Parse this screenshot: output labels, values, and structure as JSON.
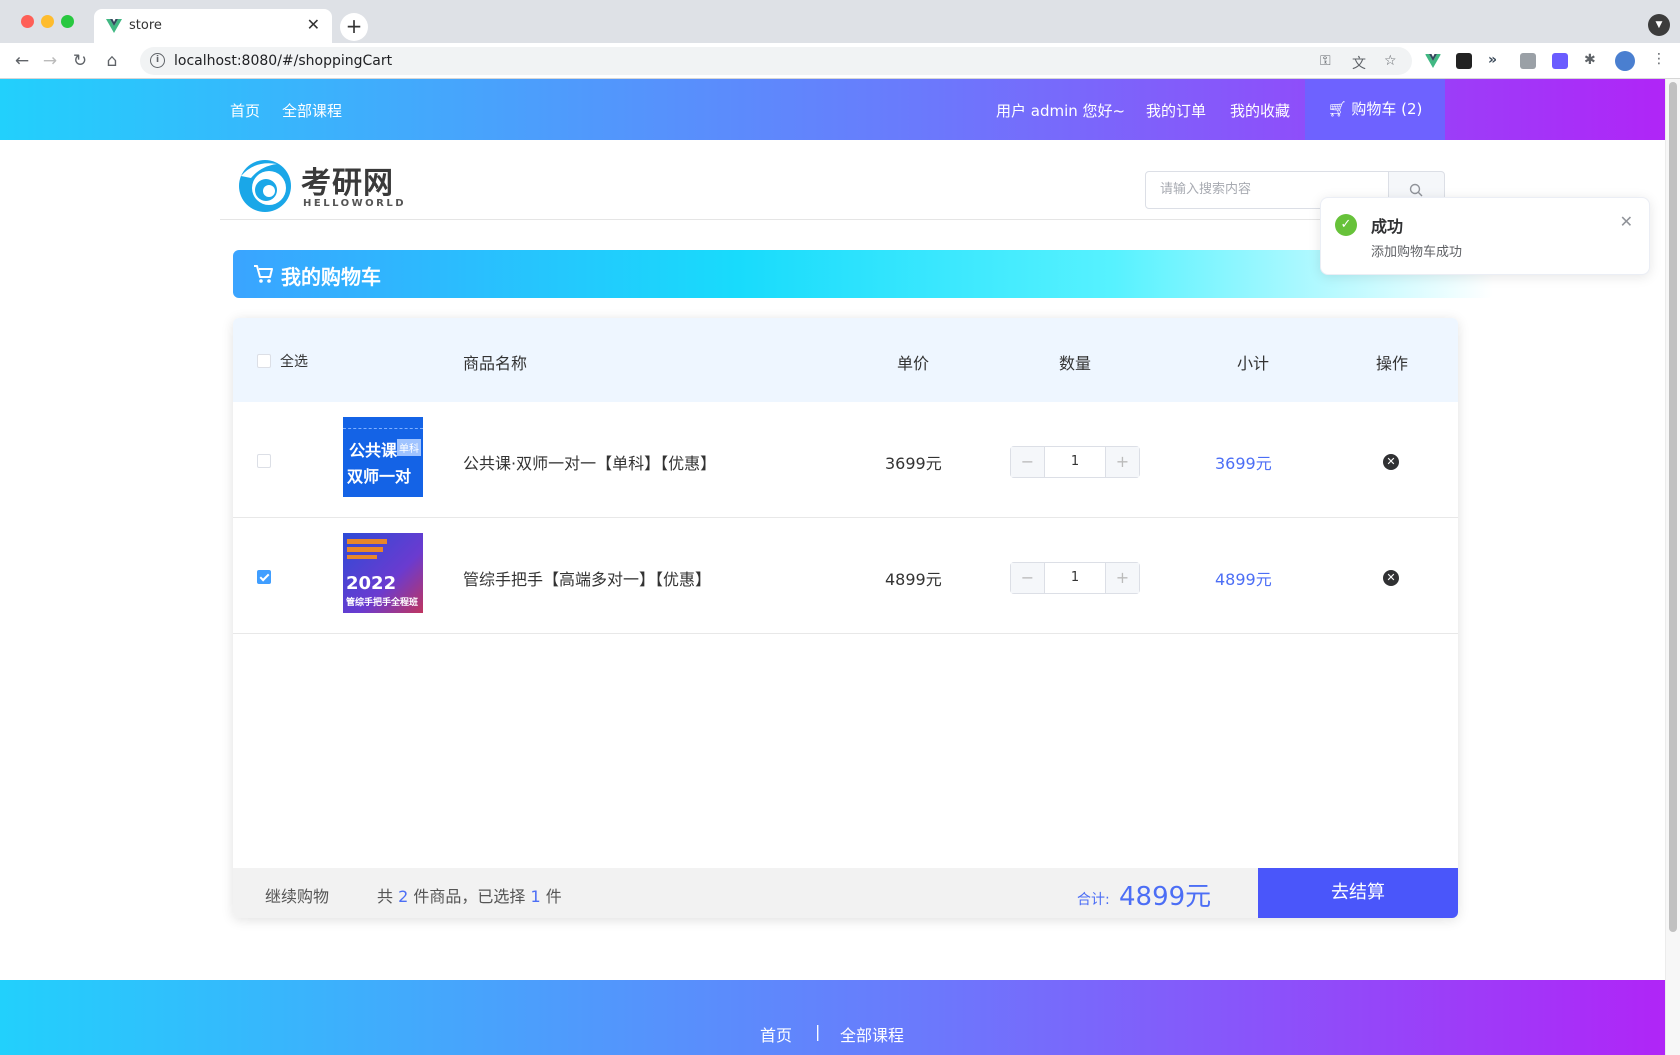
{
  "browser": {
    "tab_title": "store",
    "url": "localhost:8080/#/shoppingCart"
  },
  "header": {
    "home": "首页",
    "all_courses": "全部课程",
    "greeting": "用户 admin 您好~",
    "my_orders": "我的订单",
    "my_favorites": "我的收藏",
    "cart": "购物车 (2)"
  },
  "logo": {
    "title": "考研网",
    "subtitle": "HELLOWORLD"
  },
  "search": {
    "placeholder": "请输入搜索内容"
  },
  "banner": {
    "title": "我的购物车"
  },
  "cart": {
    "headers": {
      "select_all": "全选",
      "name": "商品名称",
      "price": "单价",
      "quantity": "数量",
      "subtotal": "小计",
      "action": "操作"
    },
    "items": [
      {
        "checked": false,
        "thumb_lines": [
          "公共课",
          "双师一对一"
        ],
        "thumb_badge": "单科",
        "name": "公共课·双师一对一【单科】【优惠】",
        "price": "3699元",
        "quantity": "1",
        "subtotal": "3699元"
      },
      {
        "checked": true,
        "thumb_year": "2022",
        "thumb_caption": "管综手把手全程班",
        "name": "管综手把手【高端多对一】【优惠】",
        "price": "4899元",
        "quantity": "1",
        "subtotal": "4899元"
      }
    ],
    "footer": {
      "continue": "继续购物",
      "summary_prefix": "共",
      "total_count": "2",
      "summary_mid": "件商品，已选择",
      "selected_count": "1",
      "summary_suffix": "件",
      "total_label": "合计:",
      "total_value": "4899元",
      "checkout": "去结算"
    }
  },
  "footer": {
    "home": "首页",
    "separator": "|",
    "all_courses": "全部课程"
  },
  "toast": {
    "title": "成功",
    "message": "添加购物车成功"
  },
  "colors": {
    "accent": "#4c6ef5",
    "header_gradient_start": "#22d0fc",
    "header_gradient_end": "#b025f7",
    "success": "#67c23a"
  }
}
